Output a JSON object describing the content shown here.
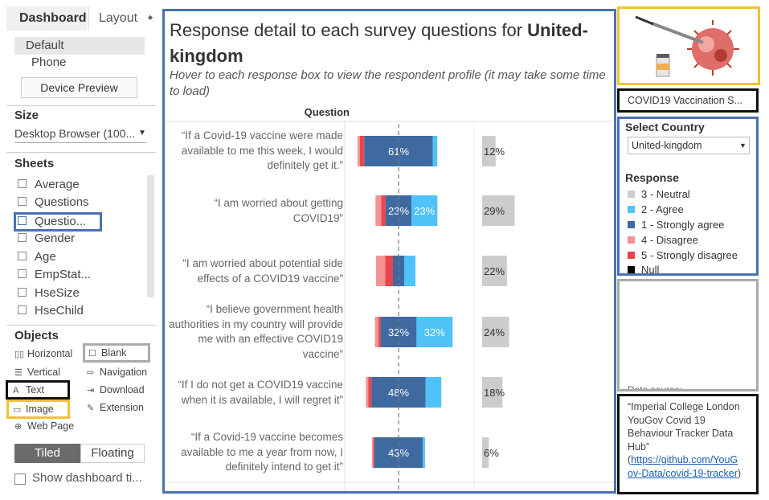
{
  "left_panel": {
    "tabs": [
      "Dashboard",
      "Layout"
    ],
    "devices": [
      "Default",
      "Phone"
    ],
    "device_preview_label": "Device Preview",
    "size_label": "Size",
    "size_value": "Desktop Browser (100...",
    "sheets_label": "Sheets",
    "sheets": [
      "Average",
      "Questions",
      "Questio...",
      "Gender",
      "Age",
      "EmpStat...",
      "HseSize",
      "HseChild"
    ],
    "objects_label": "Objects",
    "objects": {
      "horizontal": "Horizontal",
      "blank": "Blank",
      "vertical": "Vertical",
      "navigation": "Navigation",
      "text": "Text",
      "download": "Download",
      "image": "Image",
      "extension": "Extension",
      "web_page": "Web Page"
    },
    "layout_tiled": "Tiled",
    "layout_floating": "Floating",
    "show_title_label": "Show dashboard ti..."
  },
  "viz": {
    "title_prefix": "Response detail to each survey questions for ",
    "title_country": "United-kingdom",
    "subtitle": "Hover to each response box to view the respondent profile (it may take some time to load)",
    "column_header": "Question"
  },
  "chart_data": {
    "type": "bar",
    "categories": [
      "“If a Covid-19 vaccine were made available to me this week, I would definitely get it.”",
      "“I am worried about getting COVID19”",
      "“I am worried about potential side effects of a COVID19 vaccine”",
      "“I believe government health authorities in my country will provide me with an effective COVID19 vaccine”",
      "“If I do not get a COVID19 vaccine when it is available, I will regret it”",
      "“If a Covid-19 vaccine becomes available to me a year from now, I definitely intend to get it”"
    ],
    "series": [
      {
        "name": "5 - Strongly disagree",
        "values": [
          4,
          4,
          7,
          2,
          3,
          1
        ]
      },
      {
        "name": "4 - Disagree",
        "values": [
          2,
          5,
          8,
          3,
          2,
          1
        ]
      },
      {
        "name": "1 - Strongly agree",
        "values": [
          61,
          23,
          10,
          32,
          48,
          43
        ]
      },
      {
        "name": "2 - Agree",
        "values": [
          4,
          23,
          10,
          32,
          14,
          2
        ]
      },
      {
        "name": "3 - Neutral",
        "values": [
          12,
          29,
          22,
          24,
          18,
          6
        ]
      }
    ],
    "bar_labels": [
      {
        "strongly_agree": "61%",
        "agree": "",
        "neutral": "12%"
      },
      {
        "strongly_agree": "23%",
        "agree": "23%",
        "neutral": "29%"
      },
      {
        "strongly_agree": "",
        "agree": "",
        "neutral": "22%"
      },
      {
        "strongly_agree": "32%",
        "agree": "32%",
        "neutral": "24%"
      },
      {
        "strongly_agree": "48%",
        "agree": "",
        "neutral": "18%"
      },
      {
        "strongly_agree": "43%",
        "agree": "",
        "neutral": "6%"
      }
    ],
    "grid": false,
    "legend_position": "right",
    "colors": {
      "neutral": "#cccccc",
      "agree": "#4fc3f7",
      "strongly_agree": "#3f6aa0",
      "disagree": "#f49292",
      "strongly_disagree": "#e8464e",
      "null": "#000000"
    }
  },
  "right_panel": {
    "title_box_text": "COVID19 Vaccination S...",
    "filter_label": "Select Country",
    "filter_value": "United-kingdom",
    "legend_title": "Response",
    "legend_items": [
      {
        "label": "3 - Neutral",
        "color": "#cccccc"
      },
      {
        "label": "2 - Agree",
        "color": "#4fc3f7"
      },
      {
        "label": "1 - Strongly agree",
        "color": "#3f6aa0"
      },
      {
        "label": "4 - Disagree",
        "color": "#f49292"
      },
      {
        "label": "5 - Strongly disagree",
        "color": "#e8464e"
      },
      {
        "label": "Null",
        "color": "#000000"
      }
    ],
    "blank_box_text": "Data source:",
    "datasource_text": "“Imperial College London YouGov Covid 19 Behaviour Tracker Data Hub”",
    "datasource_link": "https://github.com/YouGov-Data/covid-19-tracker",
    "datasource_link_line1": "https://github.com/YouG",
    "datasource_link_line2": "ov-Data/covid-19-tracker",
    "paren_open": "(",
    "paren_close": ")"
  },
  "image": {
    "icon": "vaccine-virus-illustration"
  }
}
